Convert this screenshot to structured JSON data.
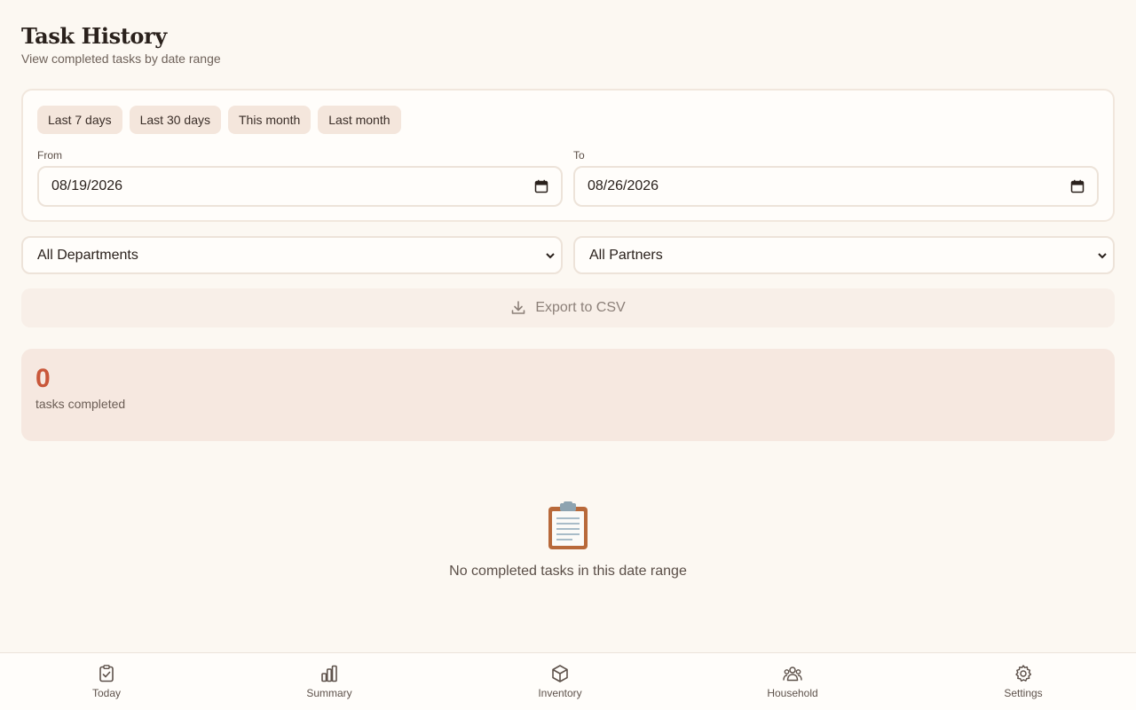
{
  "header": {
    "title": "Task History",
    "subtitle": "View completed tasks by date range"
  },
  "range": {
    "presets": [
      "Last 7 days",
      "Last 30 days",
      "This month",
      "Last month"
    ],
    "from_label": "From",
    "from_value": "08/19/2026",
    "to_label": "To",
    "to_value": "08/26/2026"
  },
  "filters": {
    "department": "All Departments",
    "partner": "All Partners"
  },
  "export": {
    "label": "Export to CSV"
  },
  "stats": {
    "count": "0",
    "label": "tasks completed"
  },
  "empty_state": {
    "icon": "clipboard-icon",
    "message": "No completed tasks in this date range"
  },
  "nav": {
    "items": [
      {
        "label": "Today",
        "icon": "clipboard-check-icon"
      },
      {
        "label": "Summary",
        "icon": "bar-chart-icon"
      },
      {
        "label": "Inventory",
        "icon": "box-icon"
      },
      {
        "label": "Household",
        "icon": "people-icon"
      },
      {
        "label": "Settings",
        "icon": "gear-icon"
      }
    ]
  },
  "colors": {
    "background": "#fcf8f2",
    "accent": "#c9573a",
    "chip": "#f4e6dc",
    "stats_background": "#f6e8e0"
  }
}
